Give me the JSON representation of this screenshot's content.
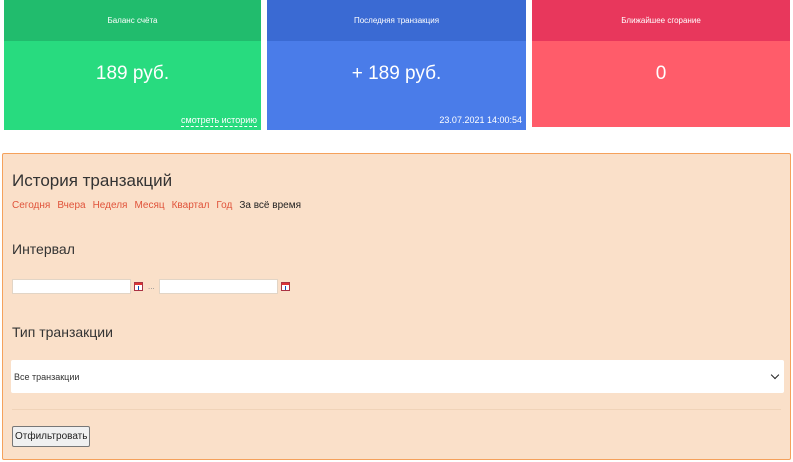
{
  "cards": {
    "balance": {
      "title": "Баланс счёта",
      "value": "189 руб.",
      "history_link": "смотреть историю",
      "color_head": "#21bc6d",
      "color_body": "#28db7f"
    },
    "last_transaction": {
      "title": "Последняя транзакция",
      "value": "+ 189 руб.",
      "timestamp": "23.07.2021 14:00:54",
      "color_head": "#3a6ad3",
      "color_body": "#4a7ce9"
    },
    "nearest_burn": {
      "title": "Ближайшее сгорание",
      "value": "0",
      "color_head": "#e8375c",
      "color_body": "#ff5c6a"
    }
  },
  "history": {
    "title": "История транзакций",
    "periods": [
      {
        "label": "Сегодня",
        "active": false
      },
      {
        "label": "Вчера",
        "active": false
      },
      {
        "label": "Неделя",
        "active": false
      },
      {
        "label": "Месяц",
        "active": false
      },
      {
        "label": "Квартал",
        "active": false
      },
      {
        "label": "Год",
        "active": false
      },
      {
        "label": "За всё время",
        "active": true
      }
    ],
    "interval_title": "Интервал",
    "date_from": "",
    "date_to": "",
    "date_separator": "...",
    "type_title": "Тип транзакции",
    "type_selected": "Все транзакции",
    "filter_button": "Отфильтровать",
    "colors": {
      "panel_bg": "#fae0c9",
      "panel_border": "#f5a15b",
      "link": "#e0533a"
    }
  }
}
